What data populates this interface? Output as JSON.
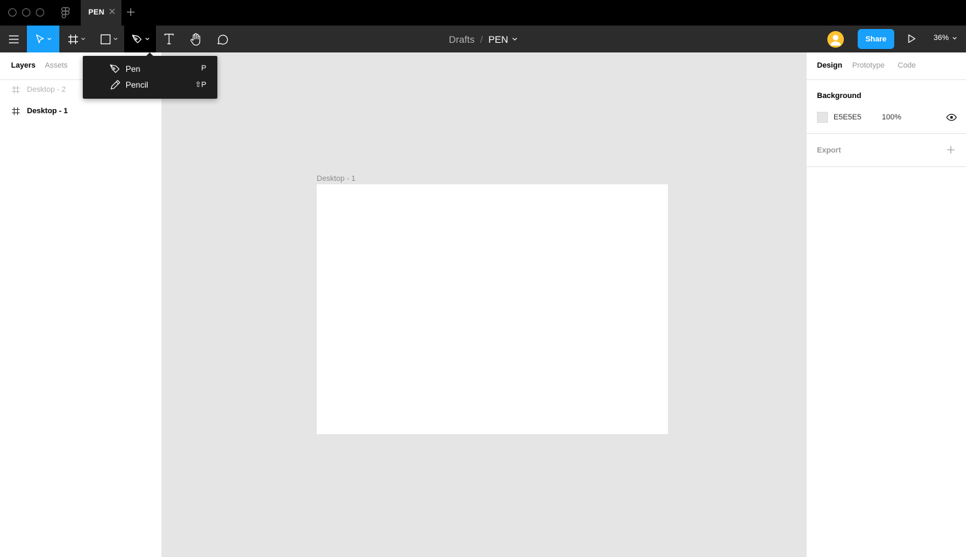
{
  "tab": {
    "label": "PEN"
  },
  "breadcrumb": {
    "project": "Drafts",
    "separator": "/",
    "file": "PEN"
  },
  "toolbar": {
    "tools": [
      {
        "icon": "menu-icon"
      },
      {
        "icon": "move-tool-icon",
        "active": true
      },
      {
        "icon": "frame-tool-icon"
      },
      {
        "icon": "rectangle-tool-icon"
      },
      {
        "icon": "pen-tool-icon",
        "open": true
      },
      {
        "icon": "text-tool-icon"
      },
      {
        "icon": "hand-tool-icon"
      },
      {
        "icon": "comment-tool-icon"
      }
    ],
    "share_label": "Share",
    "zoom": "36%"
  },
  "pen_menu": {
    "items": [
      {
        "label": "Pen",
        "shortcut": "P",
        "icon": "pen-icon"
      },
      {
        "label": "Pencil",
        "shortcut": "⇧P",
        "icon": "pencil-icon"
      }
    ]
  },
  "left_panel": {
    "tabs": [
      {
        "label": "Layers",
        "active": true
      },
      {
        "label": "Assets",
        "active": false
      }
    ],
    "layers": [
      {
        "label": "Desktop - 2",
        "state": "faded"
      },
      {
        "label": "Desktop - 1",
        "state": "normal"
      }
    ]
  },
  "canvas": {
    "frame_label": "Desktop - 1"
  },
  "right_panel": {
    "tabs": [
      {
        "label": "Design",
        "active": true
      },
      {
        "label": "Prototype",
        "active": false
      },
      {
        "label": "Code",
        "active": false
      }
    ],
    "background": {
      "title": "Background",
      "hex": "E5E5E5",
      "opacity": "100%",
      "color": "#E5E5E5"
    },
    "export": {
      "title": "Export"
    }
  },
  "colors": {
    "accent": "#18A0FB",
    "toolbar": "#2C2C2C",
    "canvas": "#E5E5E5",
    "avatar": "#FDC130"
  }
}
